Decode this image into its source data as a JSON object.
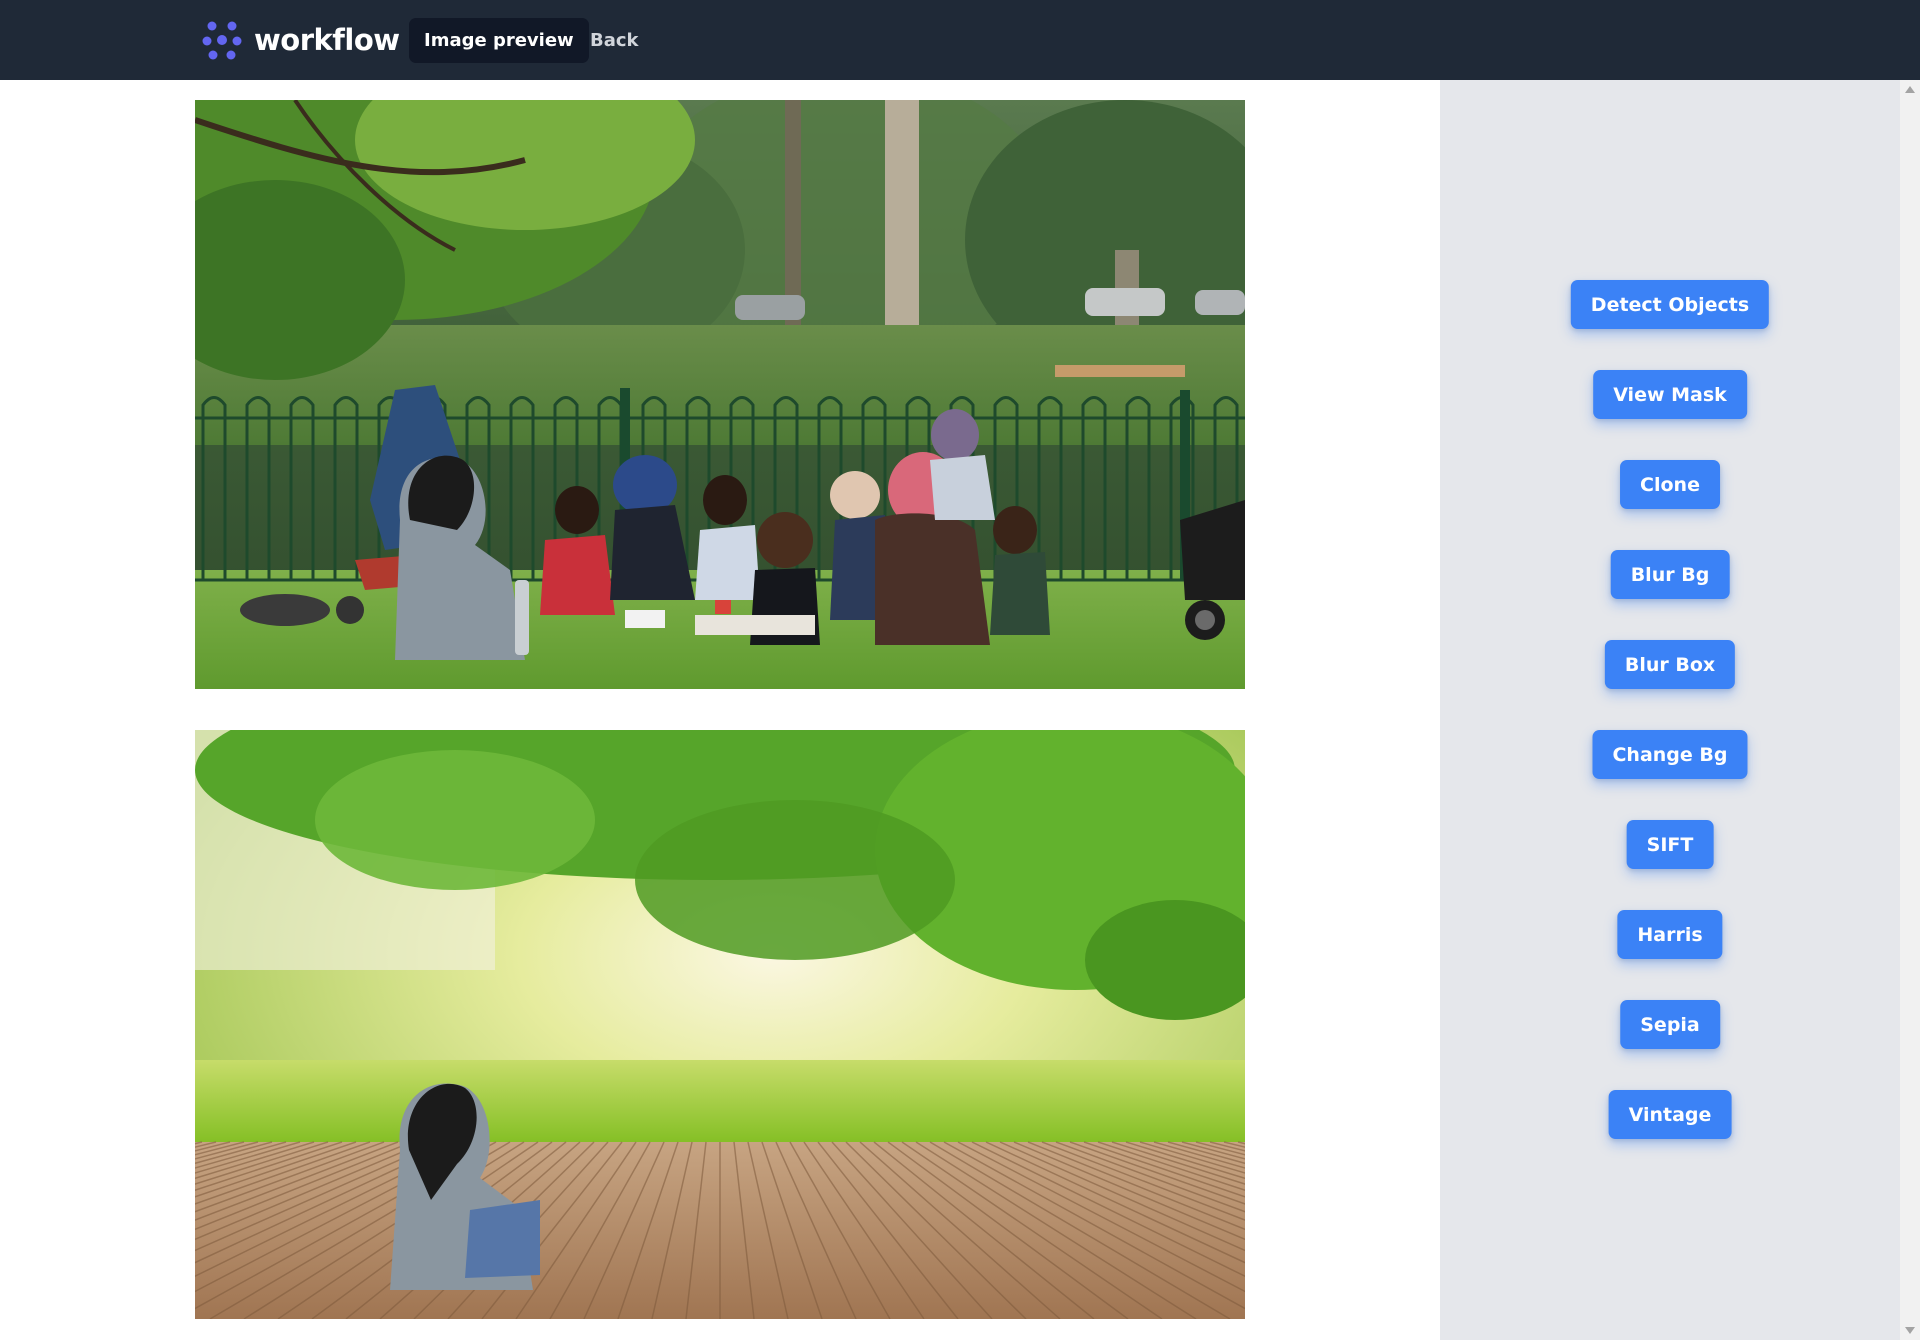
{
  "header": {
    "brand_name": "workflow",
    "logo_icon": "workflow-logo-icon",
    "nav": [
      {
        "label": "Image preview",
        "active": true
      },
      {
        "label": "Back",
        "active": false
      }
    ]
  },
  "images": {
    "original": {
      "icon": "picnic-photo"
    },
    "result": {
      "icon": "background-replaced-photo"
    }
  },
  "actions": [
    {
      "label": "Detect Objects"
    },
    {
      "label": "View Mask"
    },
    {
      "label": "Clone"
    },
    {
      "label": "Blur Bg"
    },
    {
      "label": "Blur Box"
    },
    {
      "label": "Change Bg"
    },
    {
      "label": "SIFT"
    },
    {
      "label": "Harris"
    },
    {
      "label": "Sepia"
    },
    {
      "label": "Vintage"
    }
  ],
  "colors": {
    "nav_bg": "#1f2937",
    "active_nav_bg": "#111827",
    "button_bg": "#3b82f6",
    "panel_bg": "#e5e7eb",
    "logo_accent": "#6366f1"
  }
}
